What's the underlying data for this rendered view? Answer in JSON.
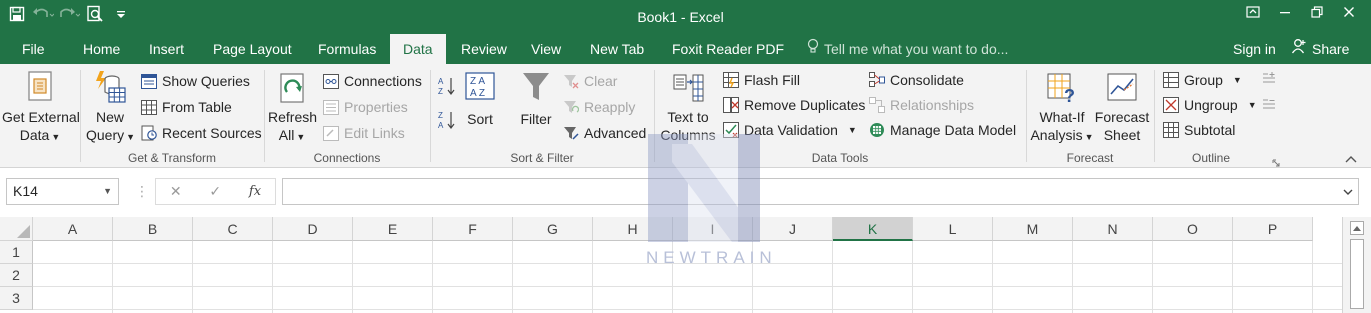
{
  "window": {
    "title": "Book1  -  Excel"
  },
  "tabs": {
    "file": "File",
    "items": [
      "Home",
      "Insert",
      "Page Layout",
      "Formulas",
      "Data",
      "Review",
      "View",
      "New Tab",
      "Foxit Reader PDF"
    ],
    "active": "Data",
    "tell_me": "Tell me what you want to do...",
    "sign_in": "Sign in",
    "share": "Share"
  },
  "ribbon": {
    "get_external": {
      "line1": "Get External",
      "line2": "Data"
    },
    "get_transform": {
      "new_query": {
        "line1": "New",
        "line2": "Query"
      },
      "show_queries": "Show Queries",
      "from_table": "From Table",
      "recent_sources": "Recent Sources",
      "label": "Get & Transform"
    },
    "connections": {
      "refresh": {
        "line1": "Refresh",
        "line2": "All"
      },
      "connections": "Connections",
      "properties": "Properties",
      "edit_links": "Edit Links",
      "label": "Connections"
    },
    "sort_filter": {
      "sort": "Sort",
      "filter": "Filter",
      "clear": "Clear",
      "reapply": "Reapply",
      "advanced": "Advanced",
      "label": "Sort & Filter"
    },
    "data_tools": {
      "text_to_columns": {
        "line1": "Text to",
        "line2": "Columns"
      },
      "flash_fill": "Flash Fill",
      "remove_duplicates": "Remove Duplicates",
      "data_validation": "Data Validation",
      "consolidate": "Consolidate",
      "relationships": "Relationships",
      "manage_data_model": "Manage Data Model",
      "label": "Data Tools"
    },
    "forecast": {
      "what_if": {
        "line1": "What-If",
        "line2": "Analysis"
      },
      "forecast_sheet": {
        "line1": "Forecast",
        "line2": "Sheet"
      },
      "label": "Forecast"
    },
    "outline": {
      "group": "Group",
      "ungroup": "Ungroup",
      "subtotal": "Subtotal",
      "label": "Outline"
    }
  },
  "formula_bar": {
    "name_box": "K14",
    "cancel": "✕",
    "enter": "✓",
    "fx": "fx",
    "value": ""
  },
  "grid": {
    "columns": [
      "A",
      "B",
      "C",
      "D",
      "E",
      "F",
      "G",
      "H",
      "I",
      "J",
      "K",
      "L",
      "M",
      "N",
      "O",
      "P"
    ],
    "selected_column": "K",
    "rows": [
      "1",
      "2",
      "3"
    ]
  },
  "watermark": {
    "text": "NEWTRAIN"
  },
  "colors": {
    "excel_green": "#217346",
    "ribbon_bg": "#f3f3f3"
  }
}
